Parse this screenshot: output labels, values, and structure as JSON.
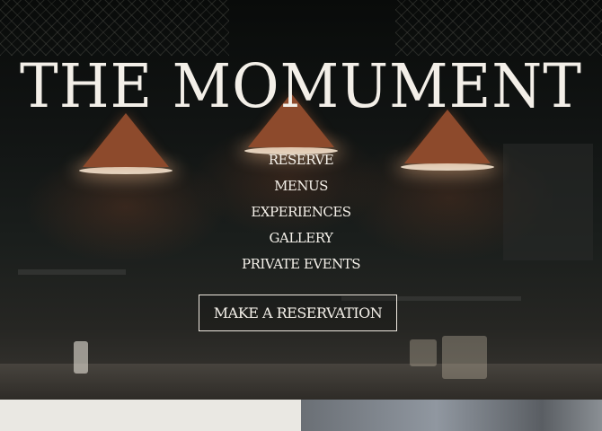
{
  "hero": {
    "title": "THE MOMUMENT",
    "nav": [
      {
        "label": "RESERVE"
      },
      {
        "label": "MENUS"
      },
      {
        "label": "EXPERIENCES"
      },
      {
        "label": "GALLERY"
      },
      {
        "label": "PRIVATE EVENTS"
      }
    ],
    "cta_label": "MAKE A RESERVATION"
  },
  "colors": {
    "text": "#f5f1ea",
    "background": "#0b0d0c",
    "lamp_copper": "#8d4a2c",
    "lower_left_panel": "#eae8e3"
  }
}
